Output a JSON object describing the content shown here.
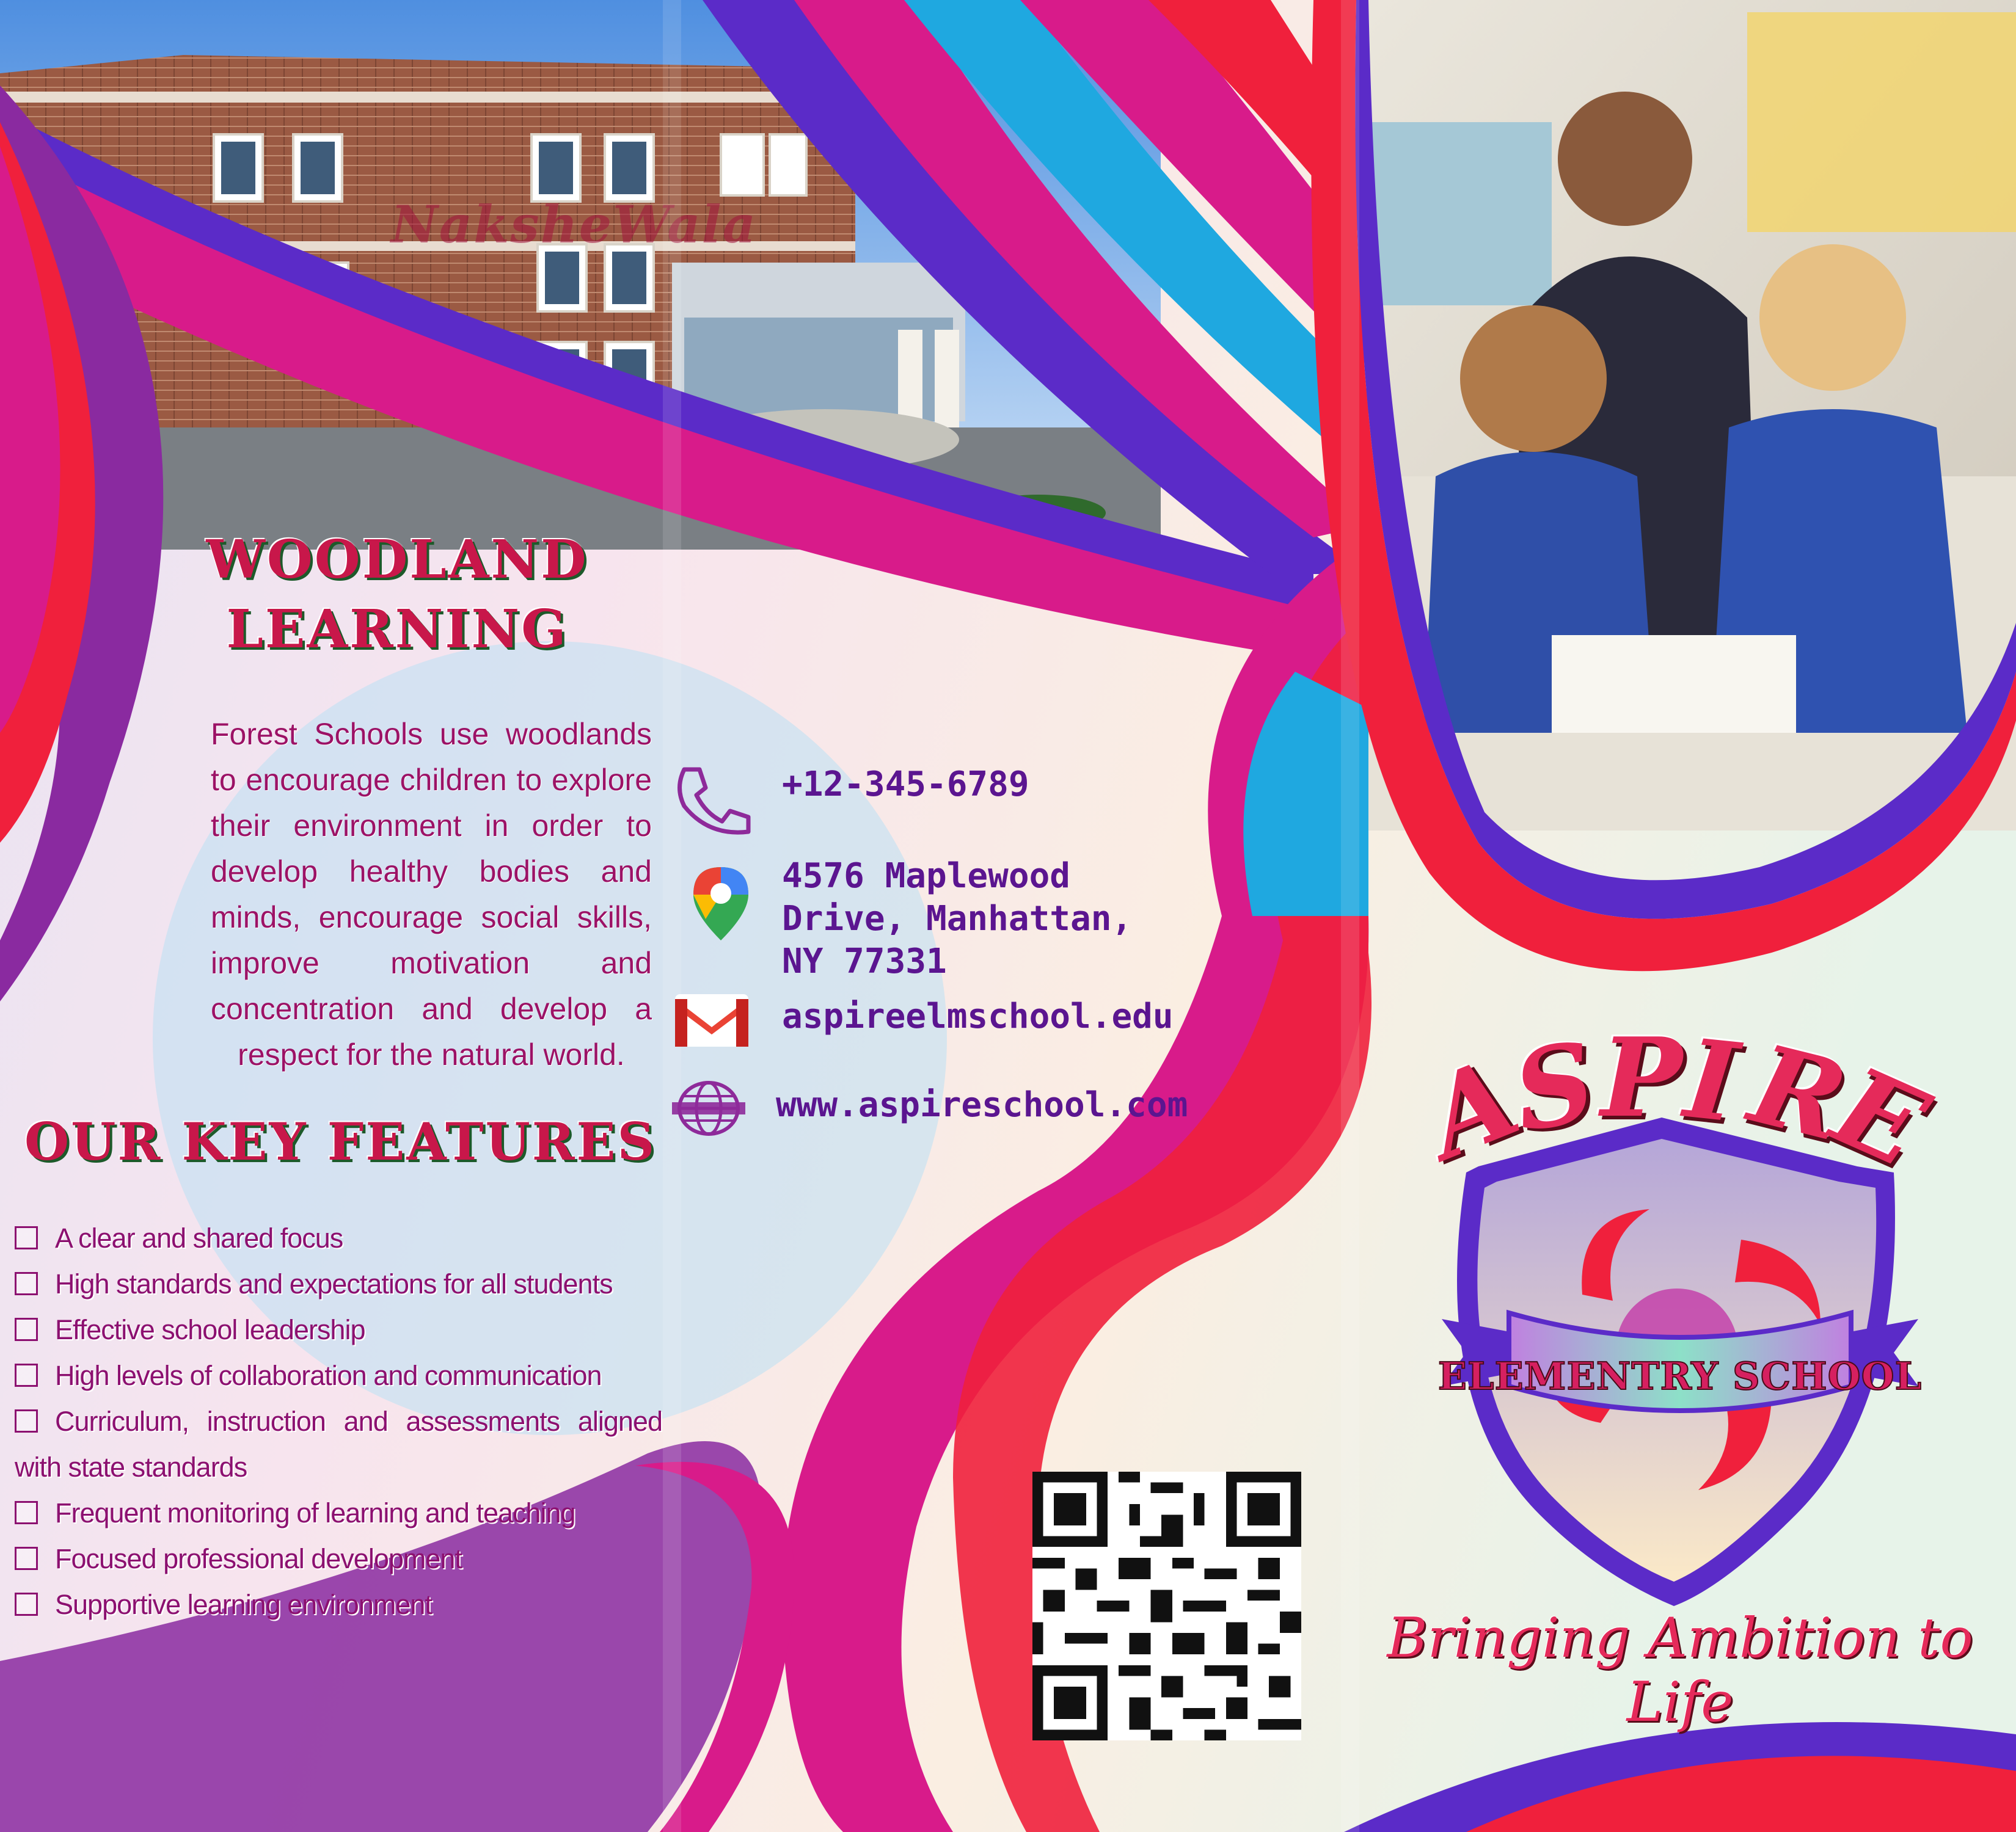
{
  "woodland": {
    "title_line1": "WOODLAND",
    "title_line2": "LEARNING",
    "body": "Forest Schools use woodlands to encourage children to explore their environment in order to develop healthy bodies and minds, encourage social skills, improve motivation and concentration and develop a respect for the natural world."
  },
  "features": {
    "title": "OUR KEY FEATURES",
    "items": [
      "A clear and shared focus",
      "High standards and expectations for all students",
      "Effective school leadership",
      "High levels of collaboration and communication",
      "Curriculum, instruction and assessments aligned with state standards",
      "Frequent monitoring of learning and teaching",
      "Focused professional development",
      "Supportive learning environment"
    ]
  },
  "contact": {
    "phone": "+12-345-6789",
    "address": "4576 Maplewood\nDrive, Manhattan,\nNY 77331",
    "email": "aspireelmschool.edu",
    "website": "www.aspireschool.com",
    "icons": [
      "phone-icon",
      "map-pin-icon",
      "gmail-icon",
      "globe-icon"
    ]
  },
  "brand": {
    "letters": [
      "A",
      "S",
      "P",
      "I",
      "R",
      "E"
    ],
    "ribbon": "ELEMENTRY SCHOOL",
    "tagline": "Bringing Ambition to Life"
  },
  "photos": {
    "watermark": "NaksheWala"
  },
  "colors": {
    "magenta": "#d81b8a",
    "red": "#f0203c",
    "purple": "#5b2bc8",
    "cyan": "#1fa8e0",
    "violet": "#8a2aa0",
    "heading_red": "#c8174a",
    "heading_shadow": "#1d5a2a",
    "body_text": "#9c1266",
    "contact_text": "#5b1590"
  }
}
